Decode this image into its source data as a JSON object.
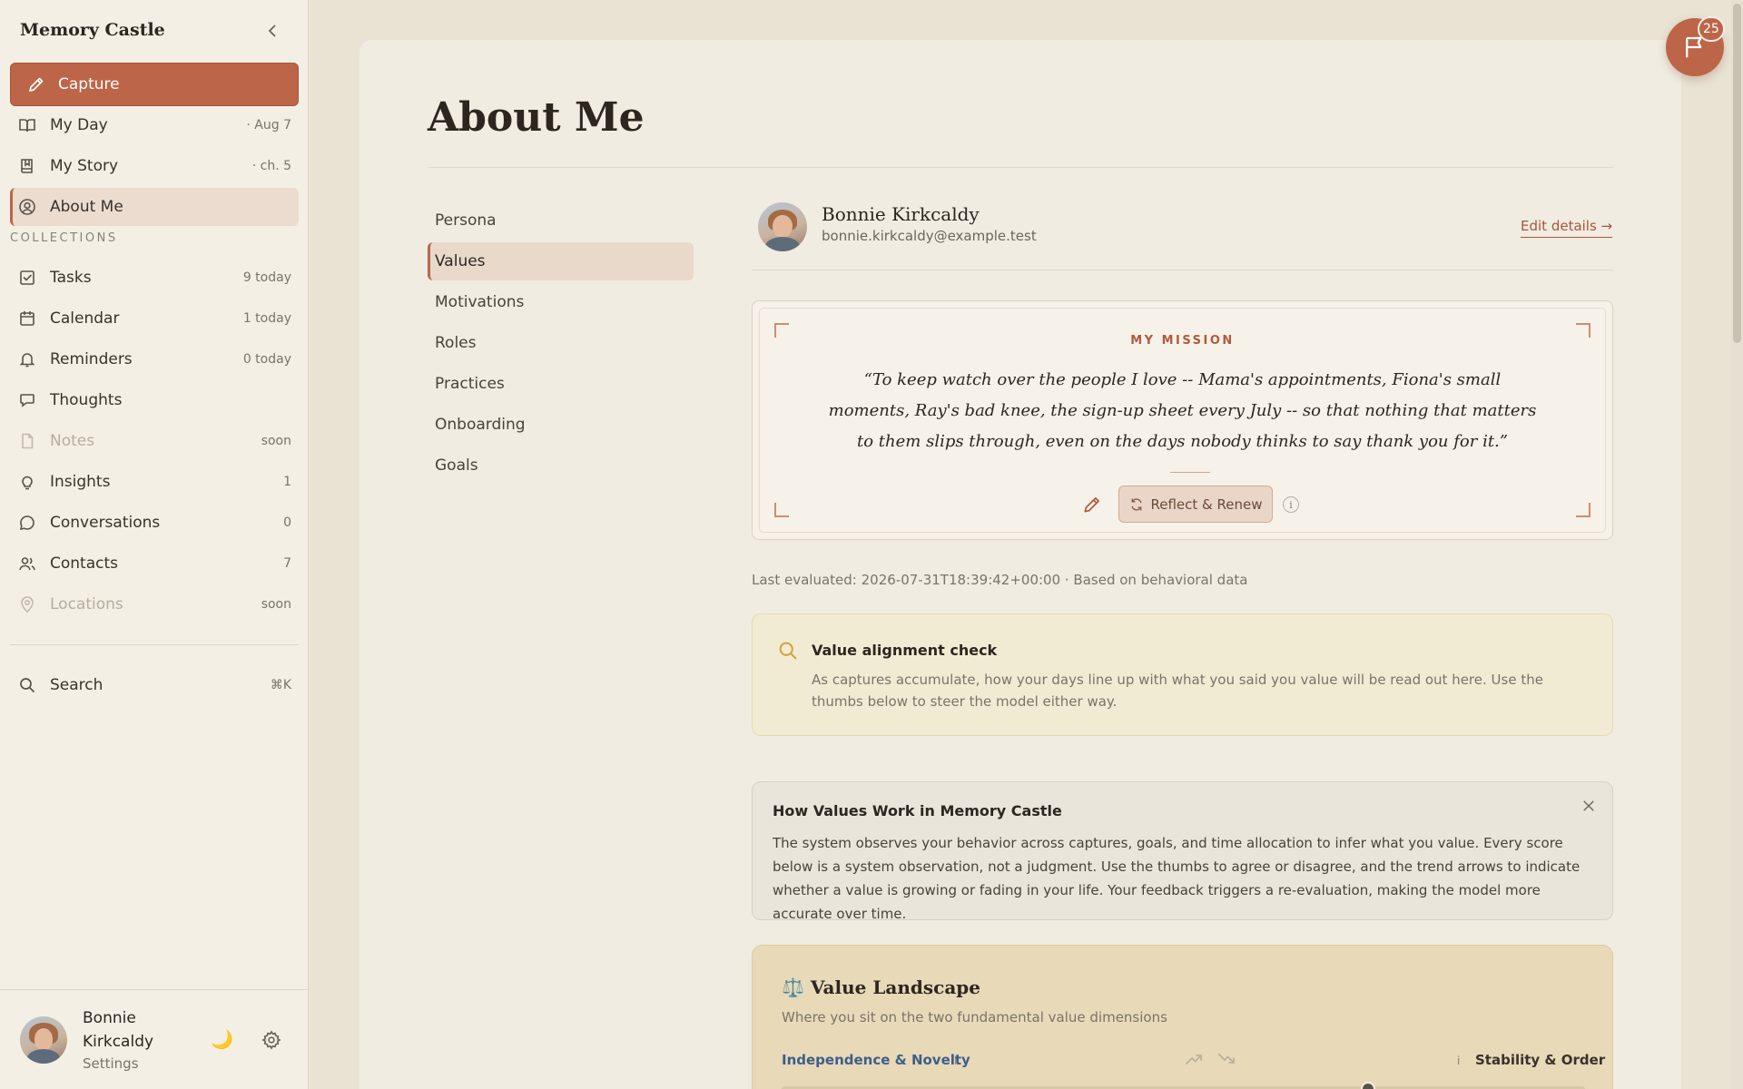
{
  "app": {
    "title": "Memory Castle"
  },
  "sidebar": {
    "capture_label": "Capture",
    "items": [
      {
        "label": "My Day",
        "meta": "· Aug 7"
      },
      {
        "label": "My Story",
        "meta": "· ch. 5"
      },
      {
        "label": "About Me",
        "meta": ""
      }
    ],
    "collections_label": "COLLECTIONS",
    "collections": [
      {
        "label": "Tasks",
        "meta": "9 today"
      },
      {
        "label": "Calendar",
        "meta": "1 today"
      },
      {
        "label": "Reminders",
        "meta": "0 today"
      },
      {
        "label": "Thoughts",
        "meta": ""
      },
      {
        "label": "Notes",
        "meta": "soon"
      },
      {
        "label": "Insights",
        "meta": "1"
      },
      {
        "label": "Conversations",
        "meta": "0"
      },
      {
        "label": "Contacts",
        "meta": "7"
      },
      {
        "label": "Locations",
        "meta": "soon"
      }
    ],
    "search": {
      "label": "Search",
      "shortcut": "⌘K"
    },
    "user": {
      "name": "Bonnie Kirkcaldy",
      "settings_label": "Settings"
    }
  },
  "page": {
    "title": "About Me",
    "subnav": [
      "Persona",
      "Values",
      "Motivations",
      "Roles",
      "Practices",
      "Onboarding",
      "Goals"
    ],
    "active_subnav": "Values"
  },
  "profile": {
    "name": "Bonnie Kirkcaldy",
    "email": "bonnie.kirkcaldy@example.test",
    "edit_label": "Edit details →"
  },
  "mission": {
    "label": "MY MISSION",
    "text": "“To keep watch over the people I love -- Mama's appointments, Fiona's small moments, Ray's bad knee, the sign-up sheet every July -- so that nothing that matters to them slips through, even on the days nobody thinks to say thank you for it.”",
    "renew_label": "Reflect & Renew",
    "info_label": "i"
  },
  "last_evaluated": "Last evaluated: 2026-07-31T18:39:42+00:00 · Based on behavioral data",
  "alignment": {
    "title": "Value alignment check",
    "body": "As captures accumulate, how your days line up with what you said you value will be read out here. Use the thumbs below to steer the model either way."
  },
  "howto": {
    "title": "How Values Work in Memory Castle",
    "body": "The system observes your behavior across captures, goals, and time allocation to infer what you value. Every score below is a system observation, not a judgment. Use the thumbs to agree or disagree, and the trend arrows to indicate whether a value is growing or fading in your life. Your feedback triggers a re-evaluation, making the model more accurate over time."
  },
  "landscape": {
    "title": "⚖️ Value Landscape",
    "subtitle": "Where you sit on the two fundamental value dimensions",
    "left_label": "Independence & Novelty",
    "right_label": "Stability & Order",
    "info": "i",
    "position": 0.73
  },
  "notifications": {
    "count": "25"
  },
  "colors": {
    "accent": "#bd6548",
    "background": "#f0ece1",
    "sidebar": "#f3efe5",
    "link_blue": "#3d5f8a"
  },
  "icons": [
    "chevron-left-icon",
    "pencil-icon",
    "book-open-icon",
    "book-icon",
    "user-circle-icon",
    "check-square-icon",
    "calendar-icon",
    "bell-icon",
    "chat-bubble-icon",
    "file-icon",
    "lightbulb-icon",
    "message-circle-icon",
    "users-icon",
    "map-pin-icon",
    "search-icon",
    "moon-icon",
    "gear-icon",
    "refresh-icon",
    "info-icon",
    "close-icon",
    "trend-up-icon",
    "trend-down-icon",
    "flag-icon"
  ]
}
